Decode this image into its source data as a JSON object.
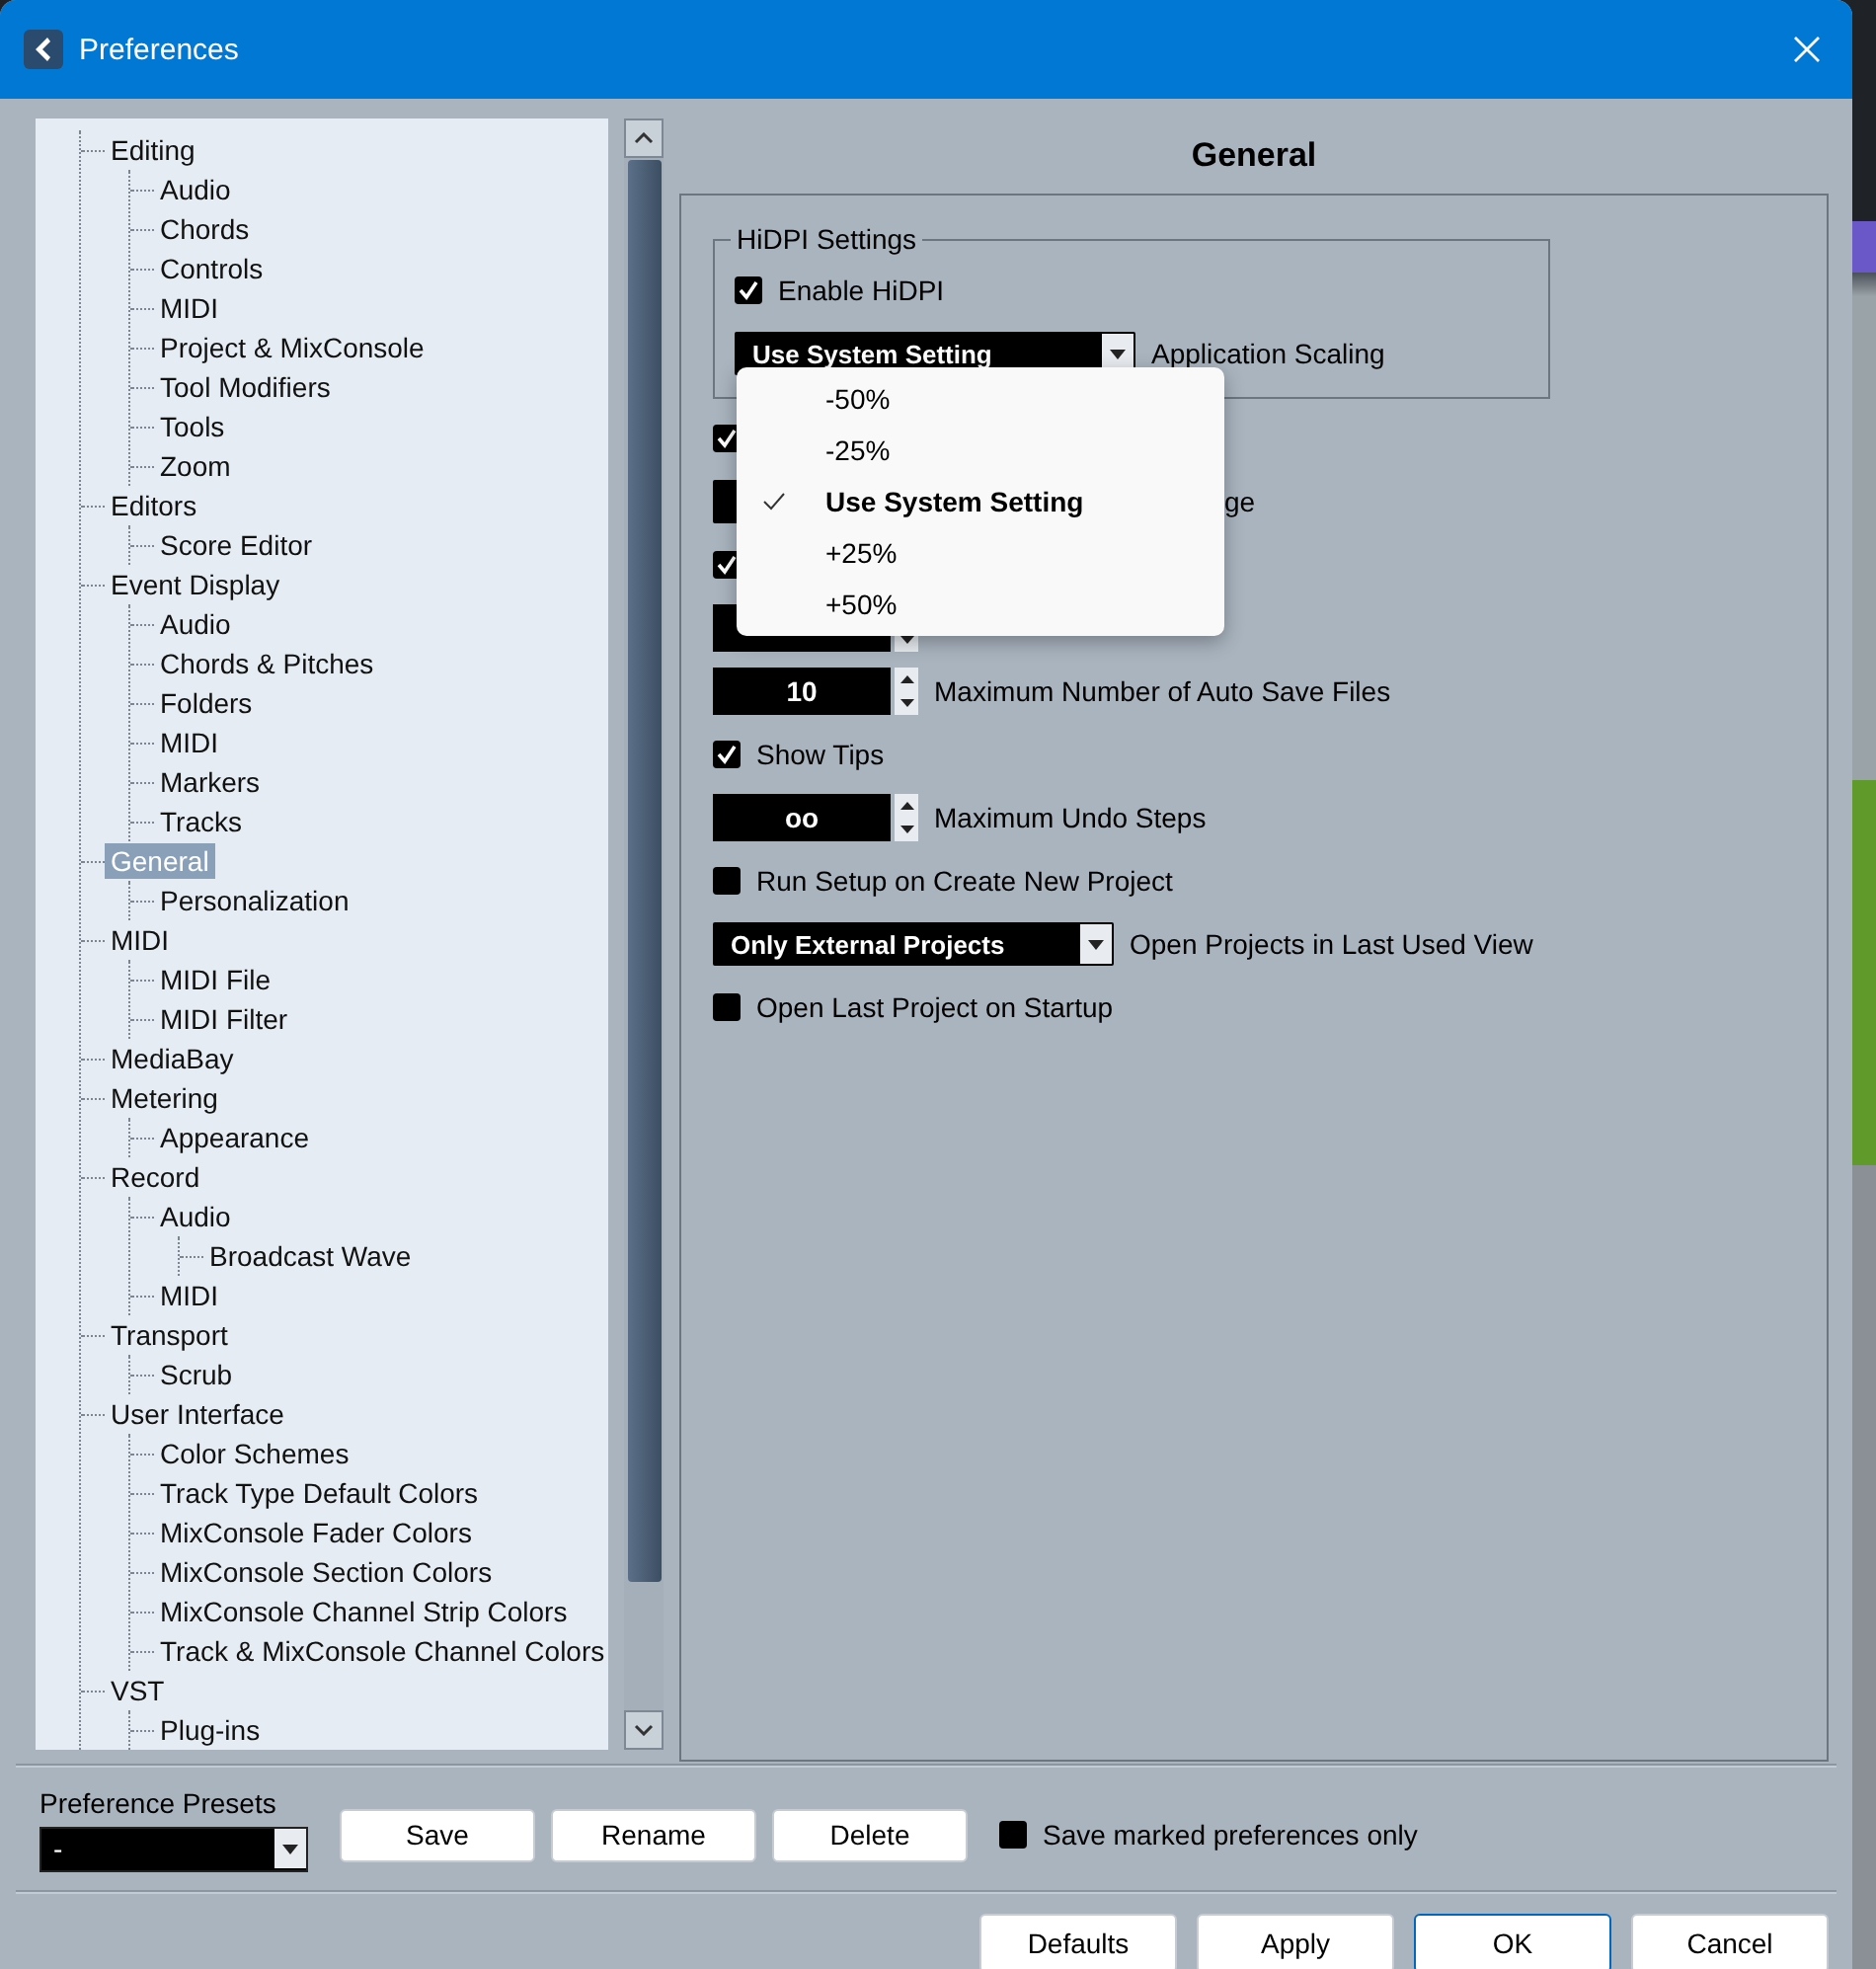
{
  "window": {
    "title": "Preferences"
  },
  "tree": [
    {
      "label": "Editing",
      "selected": false,
      "children": [
        {
          "label": "Audio",
          "selected": false
        },
        {
          "label": "Chords",
          "selected": false
        },
        {
          "label": "Controls",
          "selected": false
        },
        {
          "label": "MIDI",
          "selected": false
        },
        {
          "label": "Project & MixConsole",
          "selected": false
        },
        {
          "label": "Tool Modifiers",
          "selected": false
        },
        {
          "label": "Tools",
          "selected": false
        },
        {
          "label": "Zoom",
          "selected": false
        }
      ]
    },
    {
      "label": "Editors",
      "selected": false,
      "children": [
        {
          "label": "Score Editor",
          "selected": false
        }
      ]
    },
    {
      "label": "Event Display",
      "selected": false,
      "children": [
        {
          "label": "Audio",
          "selected": false
        },
        {
          "label": "Chords & Pitches",
          "selected": false
        },
        {
          "label": "Folders",
          "selected": false
        },
        {
          "label": "MIDI",
          "selected": false
        },
        {
          "label": "Markers",
          "selected": false
        },
        {
          "label": "Tracks",
          "selected": false
        }
      ]
    },
    {
      "label": "General",
      "selected": true,
      "children": [
        {
          "label": "Personalization",
          "selected": false
        }
      ]
    },
    {
      "label": "MIDI",
      "selected": false,
      "children": [
        {
          "label": "MIDI File",
          "selected": false
        },
        {
          "label": "MIDI Filter",
          "selected": false
        }
      ]
    },
    {
      "label": "MediaBay",
      "selected": false
    },
    {
      "label": "Metering",
      "selected": false,
      "children": [
        {
          "label": "Appearance",
          "selected": false
        }
      ]
    },
    {
      "label": "Record",
      "selected": false,
      "children": [
        {
          "label": "Audio",
          "selected": false,
          "children": [
            {
              "label": "Broadcast Wave",
              "selected": false
            }
          ]
        },
        {
          "label": "MIDI",
          "selected": false
        }
      ]
    },
    {
      "label": "Transport",
      "selected": false,
      "children": [
        {
          "label": "Scrub",
          "selected": false
        }
      ]
    },
    {
      "label": "User Interface",
      "selected": false,
      "children": [
        {
          "label": "Color Schemes",
          "selected": false
        },
        {
          "label": "Track Type Default Colors",
          "selected": false
        },
        {
          "label": "MixConsole Fader Colors",
          "selected": false
        },
        {
          "label": "MixConsole Section Colors",
          "selected": false
        },
        {
          "label": "MixConsole Channel Strip Colors",
          "selected": false
        },
        {
          "label": "Track & MixConsole Channel Colors",
          "selected": false
        }
      ]
    },
    {
      "label": "VST",
      "selected": false,
      "children": [
        {
          "label": "Plug-ins",
          "selected": false
        }
      ]
    }
  ],
  "page": {
    "title": "General",
    "hidpi_group": {
      "title": "HiDPI Settings",
      "items": [
        {
          "kind": "checkbox",
          "label": "Enable HiDPI",
          "checked": true
        },
        {
          "kind": "dropdown",
          "value": "Use System Setting",
          "caption": "Application Scaling",
          "expanded": true,
          "options": [
            {
              "label": "-50%",
              "selected": false
            },
            {
              "label": "-25%",
              "selected": false
            },
            {
              "label": "Use System Setting",
              "selected": true
            },
            {
              "label": "+25%",
              "selected": false
            },
            {
              "label": "+50%",
              "selected": false
            }
          ]
        }
      ]
    },
    "settings": [
      {
        "kind": "checkbox",
        "checked": true
      },
      {
        "kind": "dropdown",
        "caption": "ge",
        "covered": true
      },
      {
        "kind": "checkbox",
        "checked": true
      },
      {
        "kind": "spin"
      },
      {
        "kind": "spin",
        "value": "10",
        "caption": "Maximum Number of Auto Save Files"
      },
      {
        "kind": "checkbox",
        "checked": true,
        "label": "Show Tips"
      },
      {
        "kind": "spin",
        "value": "oo",
        "caption": "Maximum Undo Steps"
      },
      {
        "kind": "checkbox",
        "checked": false,
        "label": "Run Setup on Create New Project"
      },
      {
        "kind": "dropdown",
        "value": "Only External Projects",
        "caption": "Open Projects in Last Used View"
      },
      {
        "kind": "checkbox",
        "checked": false,
        "label": "Open Last Project on Startup"
      }
    ]
  },
  "presets": {
    "label": "Preference Presets",
    "value": "-",
    "buttons": [
      "Save",
      "Rename",
      "Delete"
    ],
    "marked_only": {
      "label": "Save marked preferences only",
      "checked": false
    }
  },
  "buttons": [
    {
      "label": "Defaults",
      "default": false
    },
    {
      "label": "Apply",
      "default": false
    },
    {
      "label": "OK",
      "default": true
    },
    {
      "label": "Cancel",
      "default": false
    }
  ]
}
